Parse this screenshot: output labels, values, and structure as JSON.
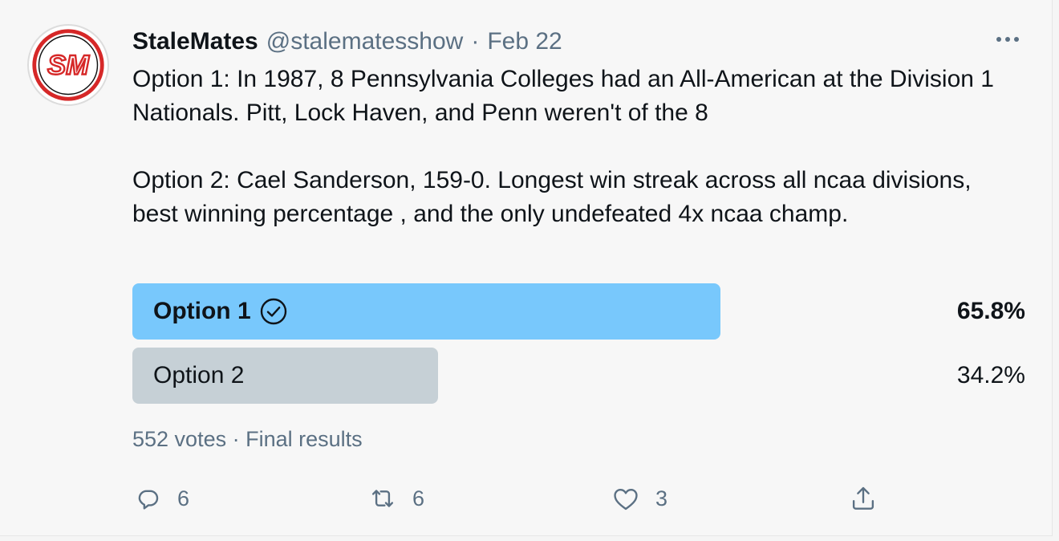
{
  "tweet": {
    "display_name": "StaleMates",
    "handle": "@stalematesshow",
    "separator": "·",
    "date": "Feb 22",
    "avatar_text": "SM",
    "text": [
      "Option 1: In 1987, 8 Pennsylvania Colleges had an All-American at the Division 1 Nationals. Pitt, Lock Haven, and Penn weren't of the 8",
      "Option 2: Cael Sanderson, 159-0. Longest win streak across all ncaa divisions, best winning percentage , and the only undefeated 4x ncaa champ."
    ]
  },
  "poll": {
    "options": [
      {
        "label": "Option 1",
        "percent_text": "65.8%",
        "percent": 65.8,
        "winner": true
      },
      {
        "label": "Option 2",
        "percent_text": "34.2%",
        "percent": 34.2,
        "winner": false
      }
    ],
    "footer": "552 votes · Final results"
  },
  "actions": {
    "reply_count": "6",
    "retweet_count": "6",
    "like_count": "3"
  },
  "colors": {
    "winner_bar": "#78c8fc",
    "other_bar": "#c6d0d6",
    "secondary_text": "#5b7083",
    "avatar_red": "#d62828"
  }
}
